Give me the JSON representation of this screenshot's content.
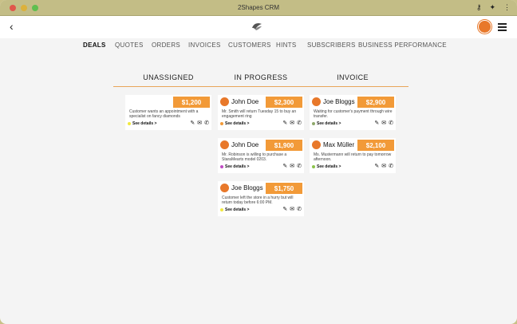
{
  "window": {
    "title": "2Shapes CRM"
  },
  "nav": [
    {
      "label": "DEALS",
      "active": true
    },
    {
      "label": "QUOTES"
    },
    {
      "label": "ORDERS"
    },
    {
      "label": "INVOICES"
    },
    {
      "label": "CUSTOMERS"
    },
    {
      "label": "HINTS"
    },
    {
      "label": "SUBSCRIBERS"
    },
    {
      "label": "BUSINESS PERFORMANCE"
    }
  ],
  "columns": [
    "UNASSIGNED",
    "IN PROGRESS",
    "INVOICE"
  ],
  "cards": [
    {
      "name": "",
      "price": "$1,200",
      "desc": "Customer wants an appointment with a specialist on fancy diamonds",
      "see": "See details >",
      "dot": "#f1e93f"
    },
    {
      "name": "John Doe",
      "price": "$2,300",
      "desc": "Mr. Smith will return Tuesday 15 to buy an engagement ring",
      "see": "See details >",
      "dot": "#f29a38"
    },
    {
      "name": "Joe Bloggs",
      "price": "$2,900",
      "desc": "Waiting for customer's payment through wire transfer.",
      "see": "See details >",
      "dot": "#8fa86b"
    },
    {
      "name": "John Doe",
      "price": "$1,900",
      "desc": "Mr. Robinson is willing to purchase a StaraMearts model 0203.",
      "see": "See details >",
      "dot": "#c04bc4"
    },
    {
      "name": "Max Müller",
      "price": "$2,100",
      "desc": "Ms. Mustermann will return to pay tomorrow afternoon.",
      "see": "See details >",
      "dot": "#8bc34a"
    },
    {
      "name": "Joe Bloggs",
      "price": "$1,750",
      "desc": "Customer left the store in a hurry but will return today before 6:00 PM.",
      "see": "See details >",
      "dot": "#f1e93f"
    }
  ],
  "icons": {
    "edit": "pencil-icon",
    "mail": "envelope-icon",
    "phone": "phone-icon"
  },
  "colors": {
    "accent": "#f29a38",
    "titlebar": "#c3bd86"
  }
}
